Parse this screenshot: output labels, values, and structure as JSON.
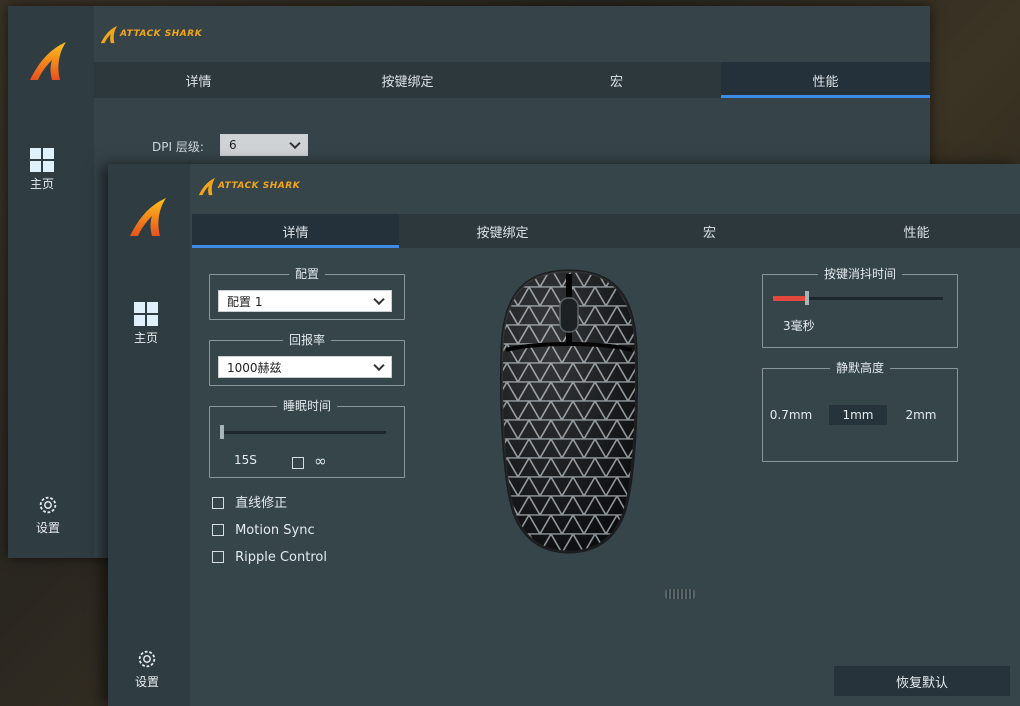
{
  "back_window": {
    "brand": "ATTACK SHARK",
    "nav_home": "主页",
    "nav_settings": "设置",
    "tabs": [
      "详情",
      "按键绑定",
      "宏",
      "性能"
    ],
    "active_tab": "性能",
    "dpi_label": "DPI 层级:",
    "dpi_value": "6"
  },
  "front_window": {
    "brand": "ATTACK SHARK",
    "nav_home": "主页",
    "nav_settings": "设置",
    "tabs": [
      "详情",
      "按键绑定",
      "宏",
      "性能"
    ],
    "active_tab": "详情",
    "config_group": {
      "title": "配置",
      "value": "配置 1"
    },
    "polling_group": {
      "title": "回报率",
      "value": "1000赫兹"
    },
    "sleep_group": {
      "title": "睡眠时间",
      "value_label": "15S",
      "infinity_label": "∞",
      "slider_fraction": 0.0,
      "infinity_checked": false
    },
    "options": [
      {
        "label": "直线修正",
        "checked": false
      },
      {
        "label": "Motion Sync",
        "checked": false
      },
      {
        "label": "Ripple Control",
        "checked": false
      }
    ],
    "debounce_group": {
      "title": "按键消抖时间",
      "value_label": "3毫秒",
      "slider_fraction": 0.2
    },
    "lod_group": {
      "title": "静默高度",
      "options": [
        "0.7mm",
        "1mm",
        "2mm"
      ],
      "selected": "1mm"
    },
    "restore_button": "恢复默认",
    "colors": {
      "accent": "#3d8be6",
      "debounce_fill": "#e2483c",
      "brand": "#f4a51a"
    }
  }
}
